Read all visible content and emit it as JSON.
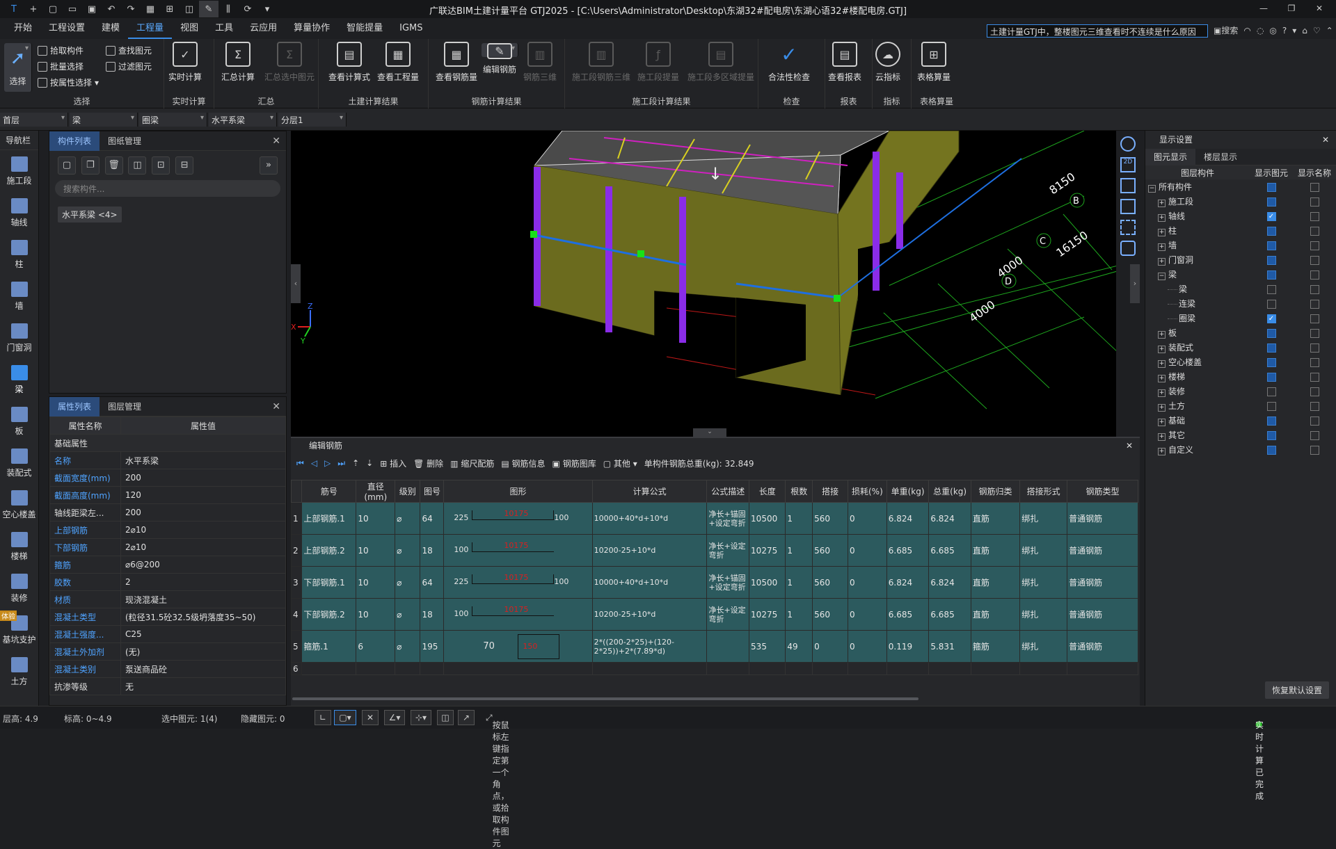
{
  "window": {
    "title": "广联达BIM土建计量平台 GTJ2025 - [C:\\Users\\Administrator\\Desktop\\东湖32#配电房\\东湖心语32#楼配电房.GTJ]"
  },
  "menu": {
    "tabs": [
      "开始",
      "工程设置",
      "建模",
      "工程量",
      "视图",
      "工具",
      "云应用",
      "算量协作",
      "智能提量",
      "IGMS"
    ],
    "active": "工程量",
    "search_value": "土建计量GTJ中，整楼图元三维查看时不连续是什么原因",
    "help_label": "搜索"
  },
  "ribbon": {
    "groups": {
      "select": {
        "label": "选择",
        "select_btn": "选择",
        "pick": "拾取构件",
        "batch": "批量选择",
        "byattr": "按属性选择",
        "find": "查找图元",
        "filter": "过滤图元"
      },
      "realtime": {
        "label": "实时计算",
        "btn": "实时计算"
      },
      "summary": {
        "label": "汇总",
        "sum_all": "汇总计算",
        "sum_sel": "汇总选中图元"
      },
      "civil": {
        "label": "土建计算结果",
        "formula": "查看计算式",
        "quantity": "查看工程量"
      },
      "rebar": {
        "label": "钢筋计算结果",
        "view_qty": "查看钢筋量",
        "edit": "编辑钢筋",
        "three_d": "钢筋三维"
      },
      "stage": {
        "label": "施工段计算结果",
        "stage3d": "施工段钢筋三维",
        "stage_qty": "施工段提量",
        "multi": "施工段多区域提量"
      },
      "check": {
        "label": "检查",
        "legal": "合法性检查"
      },
      "report": {
        "label": "报表",
        "view": "查看报表"
      },
      "index": {
        "label": "指标",
        "cloud": "云指标"
      },
      "table": {
        "label": "表格算量",
        "btn": "表格算量"
      }
    }
  },
  "selectors": [
    "首层",
    "梁",
    "圈梁",
    "水平系梁",
    "分层1"
  ],
  "nav": {
    "title": "导航栏",
    "items": [
      "施工段",
      "轴线",
      "柱",
      "墙",
      "门窗洞",
      "梁",
      "板",
      "装配式",
      "空心楼盖",
      "楼梯",
      "装修",
      "基坑支护",
      "土方"
    ],
    "active": "梁",
    "badge": "体验"
  },
  "component_panel": {
    "tabs": [
      "构件列表",
      "图纸管理"
    ],
    "search_placeholder": "搜索构件...",
    "item": "水平系梁 <4>"
  },
  "property_panel": {
    "tabs": [
      "属性列表",
      "图层管理"
    ],
    "headers": [
      "属性名称",
      "属性值"
    ],
    "group": "基础属性",
    "rows": [
      {
        "name": "名称",
        "value": "水平系梁",
        "blue": true
      },
      {
        "name": "截面宽度(mm)",
        "value": "200",
        "blue": true
      },
      {
        "name": "截面高度(mm)",
        "value": "120",
        "blue": true
      },
      {
        "name": "轴线距梁左...",
        "value": "200",
        "blue": false
      },
      {
        "name": "上部钢筋",
        "value": "2⌀10",
        "blue": true
      },
      {
        "name": "下部钢筋",
        "value": "2⌀10",
        "blue": true
      },
      {
        "name": "箍筋",
        "value": "⌀6@200",
        "blue": true
      },
      {
        "name": "胶数",
        "value": "2",
        "blue": true
      },
      {
        "name": "材质",
        "value": "现浇混凝土",
        "blue": true
      },
      {
        "name": "混凝土类型",
        "value": "(粒径31.5砼32.5级坍落度35~50)",
        "blue": true
      },
      {
        "name": "混凝土强度...",
        "value": "C25",
        "blue": true
      },
      {
        "name": "混凝土外加剂",
        "value": "(无)",
        "blue": true
      },
      {
        "name": "混凝土类别",
        "value": "泵送商品砼",
        "blue": true
      },
      {
        "name": "抗渗等级",
        "value": "无",
        "blue": false
      }
    ]
  },
  "viewport": {
    "dims": [
      "8150",
      "16150",
      "4000",
      "4000"
    ],
    "axes": [
      "B",
      "C",
      "D"
    ],
    "axis_labels": [
      "X",
      "Y",
      "Z"
    ]
  },
  "rebar_editor": {
    "title": "编辑钢筋",
    "tools": [
      "插入",
      "删除",
      "缩尺配筋",
      "钢筋信息",
      "钢筋图库",
      "其他"
    ],
    "total_label": "单构件钢筋总重(kg): 32.849",
    "headers": [
      "筋号",
      "直径(mm)",
      "级别",
      "图号",
      "图形",
      "计算公式",
      "公式描述",
      "长度",
      "根数",
      "搭接",
      "损耗(%)",
      "单重(kg)",
      "总重(kg)",
      "钢筋归类",
      "搭接形式",
      "钢筋类型"
    ],
    "rows": [
      {
        "no": "1",
        "name": "上部钢筋.1",
        "dia": "10",
        "grade": "⌀",
        "fig": "64",
        "left": "225",
        "mid": "10175",
        "right": "100",
        "formula": "10000+40*d+10*d",
        "desc": "净长+锚固+设定弯折",
        "len": "10500",
        "count": "1",
        "lap": "560",
        "loss": "0",
        "unit": "6.824",
        "total": "6.824",
        "cat": "直筋",
        "laptype": "绑扎",
        "type": "普通钢筋"
      },
      {
        "no": "2",
        "name": "上部钢筋.2",
        "dia": "10",
        "grade": "⌀",
        "fig": "18",
        "left": "100",
        "mid": "10175",
        "right": "",
        "formula": "10200-25+10*d",
        "desc": "净长+设定弯折",
        "len": "10275",
        "count": "1",
        "lap": "560",
        "loss": "0",
        "unit": "6.685",
        "total": "6.685",
        "cat": "直筋",
        "laptype": "绑扎",
        "type": "普通钢筋"
      },
      {
        "no": "3",
        "name": "下部钢筋.1",
        "dia": "10",
        "grade": "⌀",
        "fig": "64",
        "left": "225",
        "mid": "10175",
        "right": "100",
        "formula": "10000+40*d+10*d",
        "desc": "净长+锚固+设定弯折",
        "len": "10500",
        "count": "1",
        "lap": "560",
        "loss": "0",
        "unit": "6.824",
        "total": "6.824",
        "cat": "直筋",
        "laptype": "绑扎",
        "type": "普通钢筋"
      },
      {
        "no": "4",
        "name": "下部钢筋.2",
        "dia": "10",
        "grade": "⌀",
        "fig": "18",
        "left": "100",
        "mid": "10175",
        "right": "",
        "formula": "10200-25+10*d",
        "desc": "净长+设定弯折",
        "len": "10275",
        "count": "1",
        "lap": "560",
        "loss": "0",
        "unit": "6.685",
        "total": "6.685",
        "cat": "直筋",
        "laptype": "绑扎",
        "type": "普通钢筋"
      },
      {
        "no": "5",
        "name": "箍筋.1",
        "dia": "6",
        "grade": "⌀",
        "fig": "195",
        "left": "70",
        "mid": "150",
        "right": "",
        "formula": "2*((200-2*25)+(120-2*25))+2*(7.89*d)",
        "desc": "",
        "len": "535",
        "count": "49",
        "lap": "0",
        "loss": "0",
        "unit": "0.119",
        "total": "5.831",
        "cat": "箍筋",
        "laptype": "绑扎",
        "type": "普通钢筋"
      }
    ],
    "empty_row": "6"
  },
  "display_settings": {
    "title": "显示设置",
    "tabs": [
      "图元显示",
      "楼层显示"
    ],
    "headers": [
      "图层构件",
      "显示图元",
      "显示名称"
    ],
    "rows": [
      {
        "name": "所有构件",
        "level": 0,
        "show": "blue",
        "label": "off"
      },
      {
        "name": "施工段",
        "level": 1,
        "show": "blue",
        "label": "off"
      },
      {
        "name": "轴线",
        "level": 1,
        "show": "on",
        "label": "off"
      },
      {
        "name": "柱",
        "level": 1,
        "show": "blue",
        "label": "off"
      },
      {
        "name": "墙",
        "level": 1,
        "show": "blue",
        "label": "off"
      },
      {
        "name": "门窗洞",
        "level": 1,
        "show": "blue",
        "label": "off"
      },
      {
        "name": "梁",
        "level": 1,
        "show": "blue",
        "label": "off"
      },
      {
        "name": "梁",
        "level": 2,
        "show": "off",
        "label": "off"
      },
      {
        "name": "连梁",
        "level": 2,
        "show": "off",
        "label": "off"
      },
      {
        "name": "圈梁",
        "level": 2,
        "show": "on",
        "label": "off"
      },
      {
        "name": "板",
        "level": 1,
        "show": "blue",
        "label": "off"
      },
      {
        "name": "装配式",
        "level": 1,
        "show": "blue",
        "label": "off"
      },
      {
        "name": "空心楼盖",
        "level": 1,
        "show": "blue",
        "label": "off"
      },
      {
        "name": "楼梯",
        "level": 1,
        "show": "blue",
        "label": "off"
      },
      {
        "name": "装修",
        "level": 1,
        "show": "off",
        "label": "off"
      },
      {
        "name": "土方",
        "level": 1,
        "show": "off",
        "label": "off"
      },
      {
        "name": "基础",
        "level": 1,
        "show": "blue",
        "label": "off"
      },
      {
        "name": "其它",
        "level": 1,
        "show": "blue",
        "label": "off"
      },
      {
        "name": "自定义",
        "level": 1,
        "show": "blue",
        "label": "off"
      }
    ],
    "restore": "恢复默认设置"
  },
  "status": {
    "floor_height": "层高:  4.9",
    "elevation": "标高:  0~4.9",
    "selected": "选中图元:  1(4)",
    "hidden": "隐藏图元:  0",
    "hint": "按鼠标左键指定第一个角点，或拾取构件图元",
    "realtime": "实时计算已完成"
  },
  "colors": {
    "accent": "#3a8de8",
    "row_bg": "#2c5a5e",
    "wall": "#6b6b1e",
    "beam": "#1e6fe0"
  }
}
